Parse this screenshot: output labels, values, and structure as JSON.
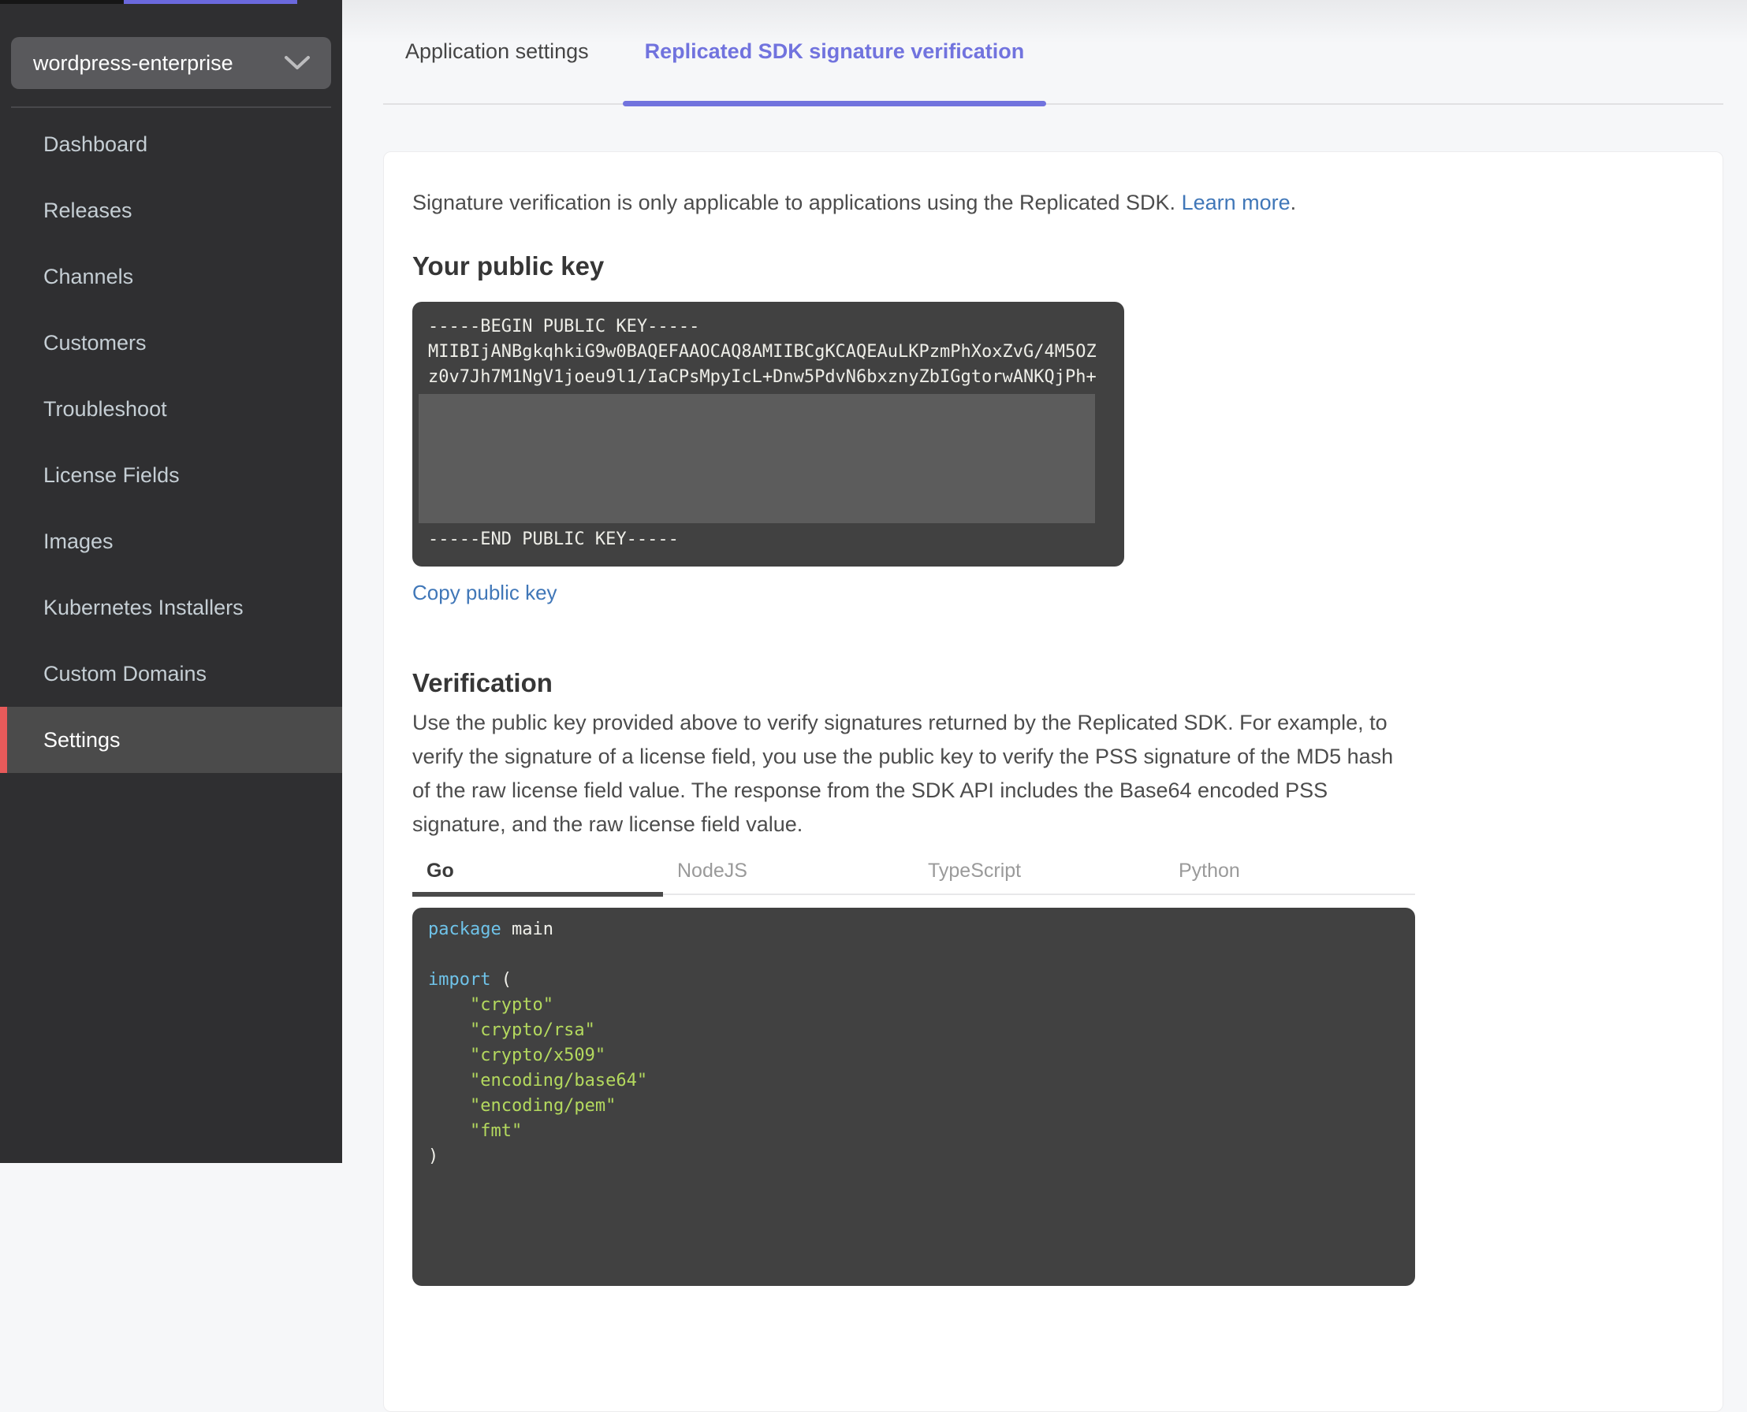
{
  "colors": {
    "top_accent": "#6b69dd",
    "sidebar_bg": "#2f2f31",
    "sidebar_active_bg": "#4b4b4b",
    "sidebar_accent_red": "#e75a5a",
    "tab_active_purple": "#7173de",
    "link_blue": "#4077b8",
    "code_bg": "#414141",
    "code_redacted_overlay": "#5c5c5c",
    "code_keyword": "#6fc3e9",
    "code_string": "#b4d95e"
  },
  "sidebar": {
    "app_selector": {
      "value": "wordpress-enterprise",
      "chevron_icon": "chevron-down"
    },
    "items": [
      {
        "label": "Dashboard"
      },
      {
        "label": "Releases"
      },
      {
        "label": "Channels"
      },
      {
        "label": "Customers"
      },
      {
        "label": "Troubleshoot"
      },
      {
        "label": "License Fields"
      },
      {
        "label": "Images"
      },
      {
        "label": "Kubernetes Installers"
      },
      {
        "label": "Custom Domains"
      },
      {
        "label": "Settings",
        "active": true
      }
    ]
  },
  "tabs": [
    {
      "label": "Application settings",
      "active": false
    },
    {
      "label": "Replicated SDK signature verification",
      "active": true
    }
  ],
  "content": {
    "intro": {
      "text": "Signature verification is only applicable to applications using the Replicated SDK.",
      "link_label": "Learn more",
      "suffix": "."
    },
    "public_key": {
      "heading": "Your public key",
      "begin_line": "-----BEGIN PUBLIC KEY-----",
      "key_line_1": "MIIBIjANBgkqhkiG9w0BAQEFAAOCAQ8AMIIBCgKCAQEAuLKPzmPhXoxZvG/4M5OZ",
      "key_line_2": "z0v7Jh7M1NgV1joeu9l1/IaCPsMpyIcL+Dnw5PdvN6bxznyZbIGgtorwANKQjPh+",
      "end_line": "-----END PUBLIC KEY-----",
      "copy_link": "Copy public key"
    },
    "verification": {
      "heading": "Verification",
      "description": "Use the public key provided above to verify signatures returned by the Replicated SDK. For example, to verify the signature of a license field, you use the public key to verify the PSS signature of the MD5 hash of the raw license field value. The response from the SDK API includes the Base64 encoded PSS signature, and the raw license field value.",
      "language_tabs": [
        {
          "label": "Go",
          "active": true
        },
        {
          "label": "NodeJS",
          "active": false
        },
        {
          "label": "TypeScript",
          "active": false
        },
        {
          "label": "Python",
          "active": false
        }
      ],
      "code_sample": {
        "language": "Go",
        "package_keyword": "package",
        "package_rest": " main",
        "import_keyword": "import",
        "import_rest": " (",
        "imports": [
          "    \"crypto\"",
          "    \"crypto/rsa\"",
          "    \"crypto/x509\"",
          "    \"encoding/base64\"",
          "    \"encoding/pem\"",
          "    \"fmt\""
        ],
        "import_close": ")"
      }
    }
  }
}
